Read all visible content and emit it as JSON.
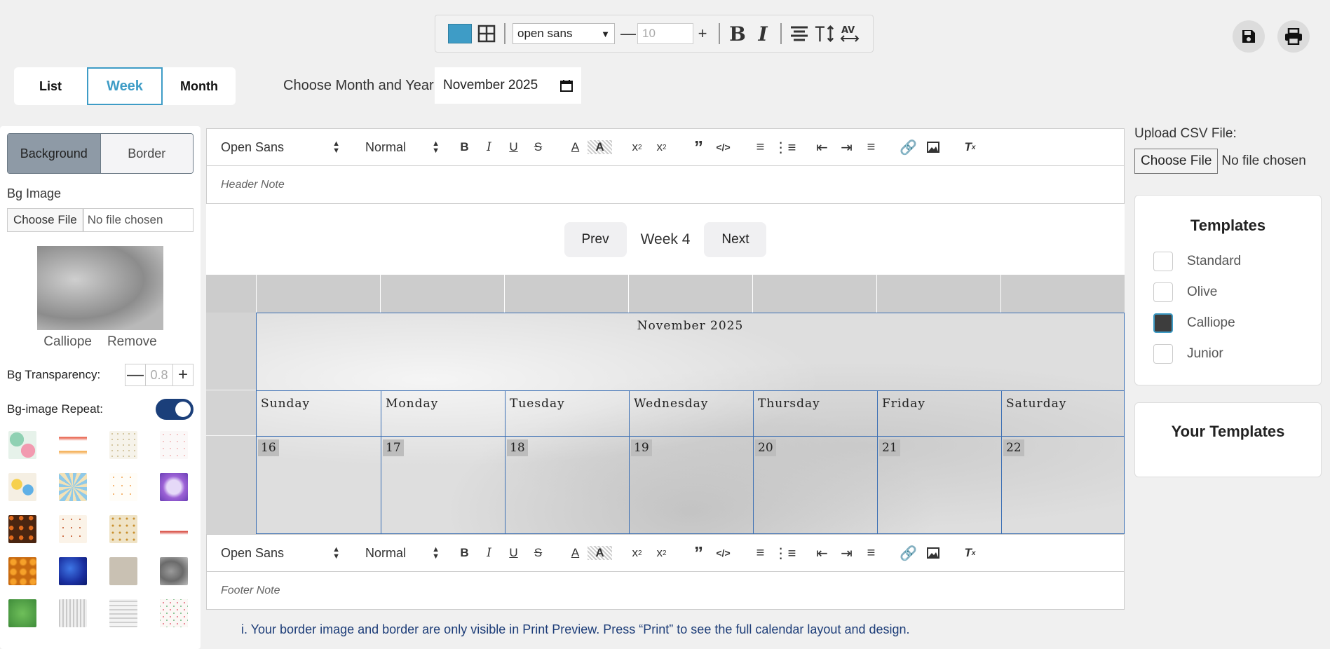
{
  "toolbar": {
    "color_swatch": "#3e9cc6",
    "font_family_value": "open sans",
    "font_size_value": "10",
    "grid_icon": "grid-icon",
    "bold_icon": "bold-icon",
    "italic_icon": "italic-icon",
    "align_icon": "align-center-icon",
    "text_height_icon": "text-height-icon",
    "letter_spacing_icon": "letter-spacing-icon"
  },
  "actions": {
    "save_icon": "save-icon",
    "print_icon": "print-icon"
  },
  "view_tabs": [
    {
      "label": "List",
      "active": false
    },
    {
      "label": "Week",
      "active": true
    },
    {
      "label": "Month",
      "active": false
    }
  ],
  "month_picker": {
    "label": "Choose Month and Year:",
    "value": "November 2025"
  },
  "left_panel": {
    "tabs": [
      {
        "label": "Background",
        "active": true
      },
      {
        "label": "Border",
        "active": false
      }
    ],
    "bg_image_label": "Bg Image",
    "file_button": "Choose File",
    "file_status": "No file chosen",
    "preview_name": "Calliope",
    "remove_label": "Remove",
    "transparency_label": "Bg Transparency:",
    "transparency_value": "0.8",
    "repeat_label": "Bg-image Repeat:",
    "repeat_on": true
  },
  "editor": {
    "font_value": "Open Sans",
    "size_value": "Normal",
    "header_placeholder": "Header Note",
    "footer_placeholder": "Footer Note"
  },
  "pager": {
    "prev": "Prev",
    "week": "Week 4",
    "next": "Next"
  },
  "calendar": {
    "title": "November 2025",
    "days": [
      "Sunday",
      "Monday",
      "Tuesday",
      "Wednesday",
      "Thursday",
      "Friday",
      "Saturday"
    ],
    "dates": [
      "16",
      "17",
      "18",
      "19",
      "20",
      "21",
      "22"
    ]
  },
  "info_note": "i. Your border image and border are only visible in Print Preview. Press “Print” to see the full calendar layout and design.",
  "right_panel": {
    "csv_label": "Upload CSV File:",
    "file_button": "Choose File",
    "file_status": "No file chosen",
    "templates_title": "Templates",
    "templates": [
      {
        "name": "Standard",
        "checked": false
      },
      {
        "name": "Olive",
        "checked": false
      },
      {
        "name": "Calliope",
        "checked": true
      },
      {
        "name": "Junior",
        "checked": false
      }
    ],
    "your_templates_title": "Your Templates"
  },
  "colors": {
    "accent": "#3e9cc6",
    "toggle": "#1b3f7a",
    "grid_line": "#3b6fb4"
  }
}
